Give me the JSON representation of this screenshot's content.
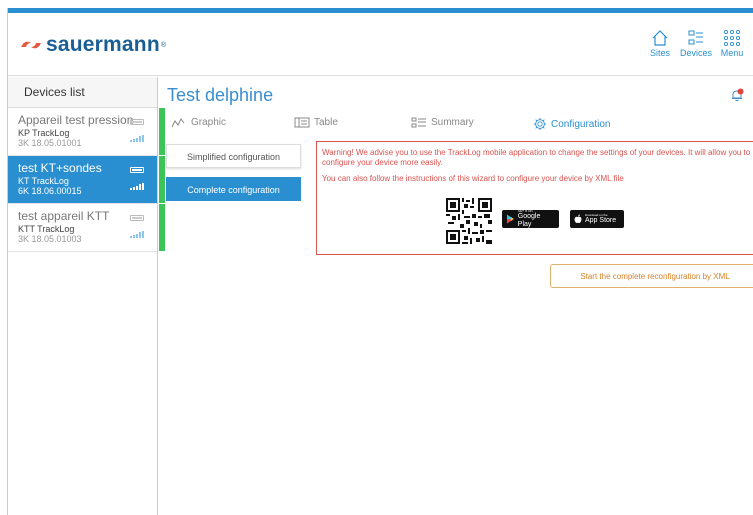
{
  "brand": {
    "name": "sauermann",
    "reg": "®",
    "color": "#1b5e96"
  },
  "nav": [
    {
      "label": "Sites",
      "icon": "home-icon"
    },
    {
      "label": "Devices",
      "icon": "devices-list-icon"
    },
    {
      "label": "Menu",
      "icon": "grid-menu-icon"
    }
  ],
  "sidebar": {
    "title": "Devices list",
    "devices": [
      {
        "name": "Appareil test pression",
        "model": "KP TrackLog",
        "serial": "3K 18.05.01001",
        "active": false
      },
      {
        "name": "test KT+sondes",
        "model": "KT TrackLog",
        "serial": "6K 18.06.00015",
        "active": true
      },
      {
        "name": "test appareil KTT",
        "model": "KTT TrackLog",
        "serial": "3K 18.05.01003",
        "active": false
      }
    ]
  },
  "main": {
    "title": "Test delphine",
    "notification_icon": "bell-icon",
    "tabs": [
      {
        "label": "Graphic",
        "icon": "graphic-icon"
      },
      {
        "label": "Table",
        "icon": "table-icon"
      },
      {
        "label": "Summary",
        "icon": "summary-icon"
      },
      {
        "label": "Configuration",
        "icon": "gear-icon"
      }
    ],
    "active_tab": "Configuration",
    "config": {
      "simplified_label": "Simplified configuration",
      "complete_label": "Complete configuration",
      "warning": "Warning! We advise you to use the TrackLog mobile application to change the settings of your devices. It will allow you to configure your device more easily.",
      "xml_info": "You can also follow the instructions of this wizard to configure your device by XML file",
      "google_play_small": "GET IT ON",
      "google_play": "Google Play",
      "app_store_small": "Download on the",
      "app_store": "App Store",
      "xml_button": "Start the complete reconfiguration by XML"
    }
  },
  "colors": {
    "accent": "#2a8fd0",
    "warning": "#d9534f",
    "active_indicator": "#3cc458",
    "xml_button": "#d9822b"
  }
}
